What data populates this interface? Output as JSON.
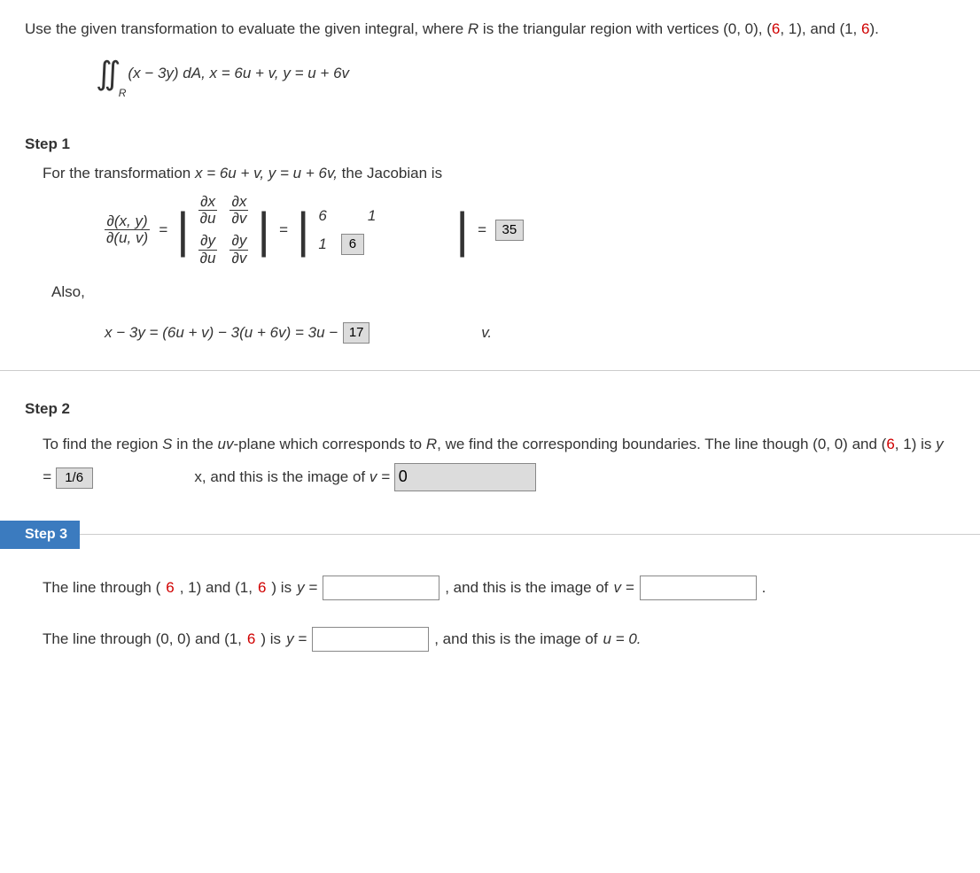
{
  "problem": {
    "intro": "Use the given transformation to evaluate the given integral, where ",
    "R": "R",
    "intro2": " is the triangular region with vertices (0, 0), (",
    "red1": "6",
    "intro3": ", 1), and (1, ",
    "red2": "6",
    "intro4": ").",
    "integral_expr": "(x − 3y) dA, x = 6u + v, y = u + 6v"
  },
  "step1": {
    "header": "Step 1",
    "line1a": "For the transformation  ",
    "line1b": "x = 6u + v, y = u + 6v,",
    "line1c": "  the Jacobian is",
    "jacobian_label_num": "∂(x, y)",
    "jacobian_label_den": "∂(u, v)",
    "dx": "∂x",
    "dy": "∂y",
    "du": "∂u",
    "dv": "∂v",
    "m11": "6",
    "m12": "1",
    "m21": "1",
    "m22_val": "6",
    "result_val": "35",
    "also": "Also,",
    "eq2a": "x − 3y = (6u + v) − 3(u + 6v) = 3u − ",
    "eq2_val": "17",
    "eq2b": "v."
  },
  "step2": {
    "header": "Step 2",
    "text1": "To find the region ",
    "S": "S",
    "text2": " in the ",
    "uv": "uv",
    "text3": "-plane which corresponds to ",
    "R": "R",
    "text4": ", we find the corresponding boundaries. The line though (0, 0) and (",
    "six1": "6",
    "text5": ", 1) is ",
    "yeq": "y = ",
    "input1_val": "1/6",
    "text6": "x, and this is the image of ",
    "veq": "v = ",
    "input2_val": "0"
  },
  "step3": {
    "header": "Step 3",
    "line1a": "The line through (",
    "six_a": "6",
    "line1b": ", 1) and (1, ",
    "six_b": "6",
    "line1c": ") is ",
    "yeq": "y = ",
    "line1d": ",  and this is the image of ",
    "veq": "v = ",
    "period": ".",
    "line2a": "The line through (0, 0) and (1, ",
    "six_c": "6",
    "line2b": ") is ",
    "line2c": ",  and this is the image of ",
    "ueq": "u = 0."
  }
}
